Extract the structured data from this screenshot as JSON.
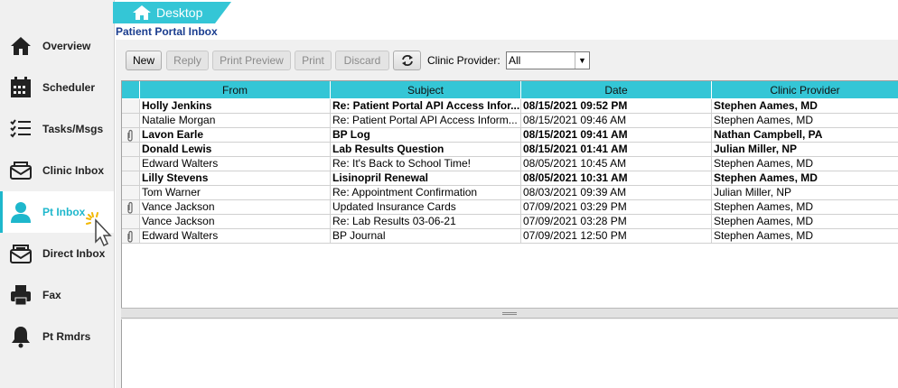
{
  "sidebar": {
    "items": [
      {
        "label": "Overview",
        "icon": "home-icon"
      },
      {
        "label": "Scheduler",
        "icon": "calendar-icon"
      },
      {
        "label": "Tasks/Msgs",
        "icon": "checklist-icon"
      },
      {
        "label": "Clinic Inbox",
        "icon": "inbox-tray-icon"
      },
      {
        "label": "Pt Inbox",
        "icon": "person-icon",
        "active": true
      },
      {
        "label": "Direct Inbox",
        "icon": "envelope-icon"
      },
      {
        "label": "Fax",
        "icon": "fax-icon"
      },
      {
        "label": "Pt Rmdrs",
        "icon": "bell-icon"
      }
    ]
  },
  "tab": {
    "label": "Desktop"
  },
  "page_title": "Patient Portal Inbox",
  "toolbar": {
    "new": "New",
    "reply": "Reply",
    "print_preview": "Print Preview",
    "print": "Print",
    "discard": "Discard",
    "provider_label": "Clinic Provider:",
    "provider_value": "All"
  },
  "table": {
    "columns": [
      "From",
      "Subject",
      "Date",
      "Clinic Provider"
    ],
    "rows": [
      {
        "from": "Holly Jenkins",
        "subject": "Re: Patient Portal API Access Infor...",
        "date": "08/15/2021 09:52 PM",
        "provider": "Stephen Aames, MD",
        "unread": true,
        "attachment": false
      },
      {
        "from": "Natalie Morgan",
        "subject": "Re: Patient Portal API Access Inform...",
        "date": "08/15/2021 09:46 AM",
        "provider": "Stephen Aames, MD",
        "unread": false,
        "attachment": false
      },
      {
        "from": "Lavon Earle",
        "subject": "BP Log",
        "date": "08/15/2021 09:41 AM",
        "provider": "Nathan Campbell, PA",
        "unread": true,
        "attachment": true
      },
      {
        "from": "Donald Lewis",
        "subject": "Lab Results Question",
        "date": "08/15/2021 01:41 AM",
        "provider": "Julian Miller, NP",
        "unread": true,
        "attachment": false
      },
      {
        "from": "Edward Walters",
        "subject": "Re: It's Back to School Time!",
        "date": "08/05/2021 10:45 AM",
        "provider": "Stephen Aames, MD",
        "unread": false,
        "attachment": false
      },
      {
        "from": "Lilly Stevens",
        "subject": "Lisinopril Renewal",
        "date": "08/05/2021 10:31 AM",
        "provider": "Stephen Aames, MD",
        "unread": true,
        "attachment": false
      },
      {
        "from": "Tom Warner",
        "subject": "Re: Appointment Confirmation",
        "date": "08/03/2021 09:39 AM",
        "provider": "Julian Miller, NP",
        "unread": false,
        "attachment": false
      },
      {
        "from": "Vance Jackson",
        "subject": "Updated Insurance Cards",
        "date": "07/09/2021 03:29 PM",
        "provider": "Stephen Aames, MD",
        "unread": false,
        "attachment": true
      },
      {
        "from": "Vance Jackson",
        "subject": "Re: Lab Results 03-06-21",
        "date": "07/09/2021 03:28 PM",
        "provider": "Stephen Aames, MD",
        "unread": false,
        "attachment": false
      },
      {
        "from": "Edward Walters",
        "subject": "BP Journal",
        "date": "07/09/2021 12:50 PM",
        "provider": "Stephen Aames, MD",
        "unread": false,
        "attachment": true
      }
    ]
  },
  "colors": {
    "accent": "#1eb7cc",
    "header": "#34c6d6",
    "title": "#1a3d8f"
  }
}
